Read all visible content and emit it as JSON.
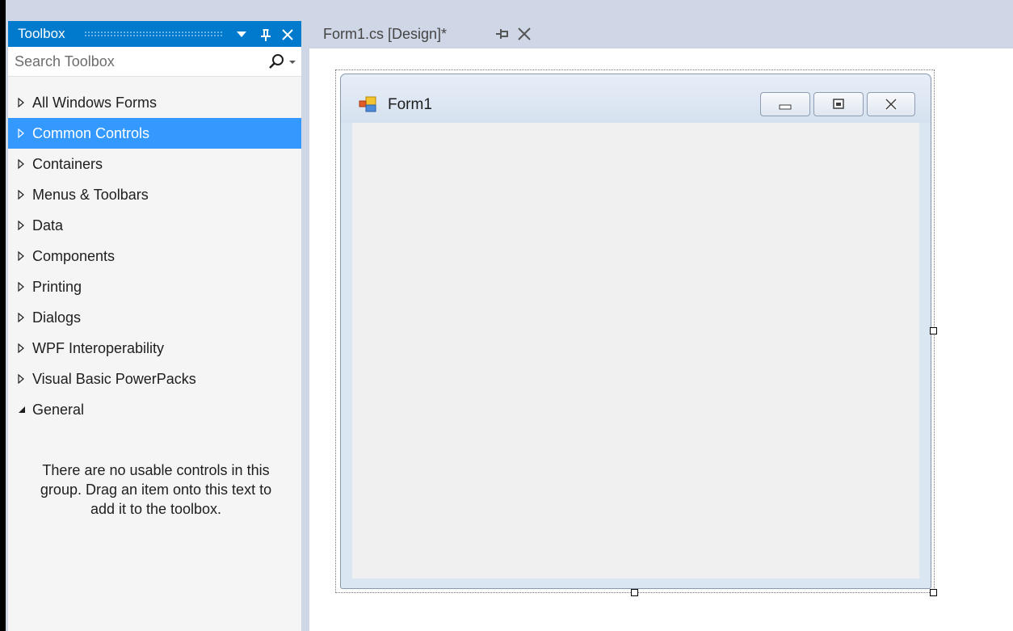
{
  "toolbox": {
    "title": "Toolbox",
    "search_placeholder": "Search Toolbox",
    "categories": [
      {
        "label": "All Windows Forms",
        "expanded": false,
        "selected": false
      },
      {
        "label": "Common Controls",
        "expanded": false,
        "selected": true
      },
      {
        "label": "Containers",
        "expanded": false,
        "selected": false
      },
      {
        "label": "Menus & Toolbars",
        "expanded": false,
        "selected": false
      },
      {
        "label": "Data",
        "expanded": false,
        "selected": false
      },
      {
        "label": "Components",
        "expanded": false,
        "selected": false
      },
      {
        "label": "Printing",
        "expanded": false,
        "selected": false
      },
      {
        "label": "Dialogs",
        "expanded": false,
        "selected": false
      },
      {
        "label": "WPF Interoperability",
        "expanded": false,
        "selected": false
      },
      {
        "label": "Visual Basic PowerPacks",
        "expanded": false,
        "selected": false
      },
      {
        "label": "General",
        "expanded": true,
        "selected": false
      }
    ],
    "empty_group_message": "There are no usable controls in this group. Drag an item onto this text to add it to the toolbox.",
    "buttons": {
      "dropdown_icon": "chevron-down-icon",
      "pin_icon": "pin-icon",
      "close_icon": "close-icon"
    }
  },
  "document_tab": {
    "label": "Form1.cs [Design]*",
    "pin_icon": "pin-icon",
    "close_icon": "close-icon"
  },
  "form": {
    "title": "Form1",
    "icon": "form-icon",
    "window_buttons": [
      "minimize-icon",
      "maximize-icon",
      "close-icon"
    ]
  },
  "colors": {
    "accent": "#007acc",
    "selection": "#3399ff",
    "panel_bg": "#f5f5f5",
    "chrome": "#cfd6e5",
    "form_frame": "#dbe6f3",
    "form_client": "#f0f0f0"
  }
}
